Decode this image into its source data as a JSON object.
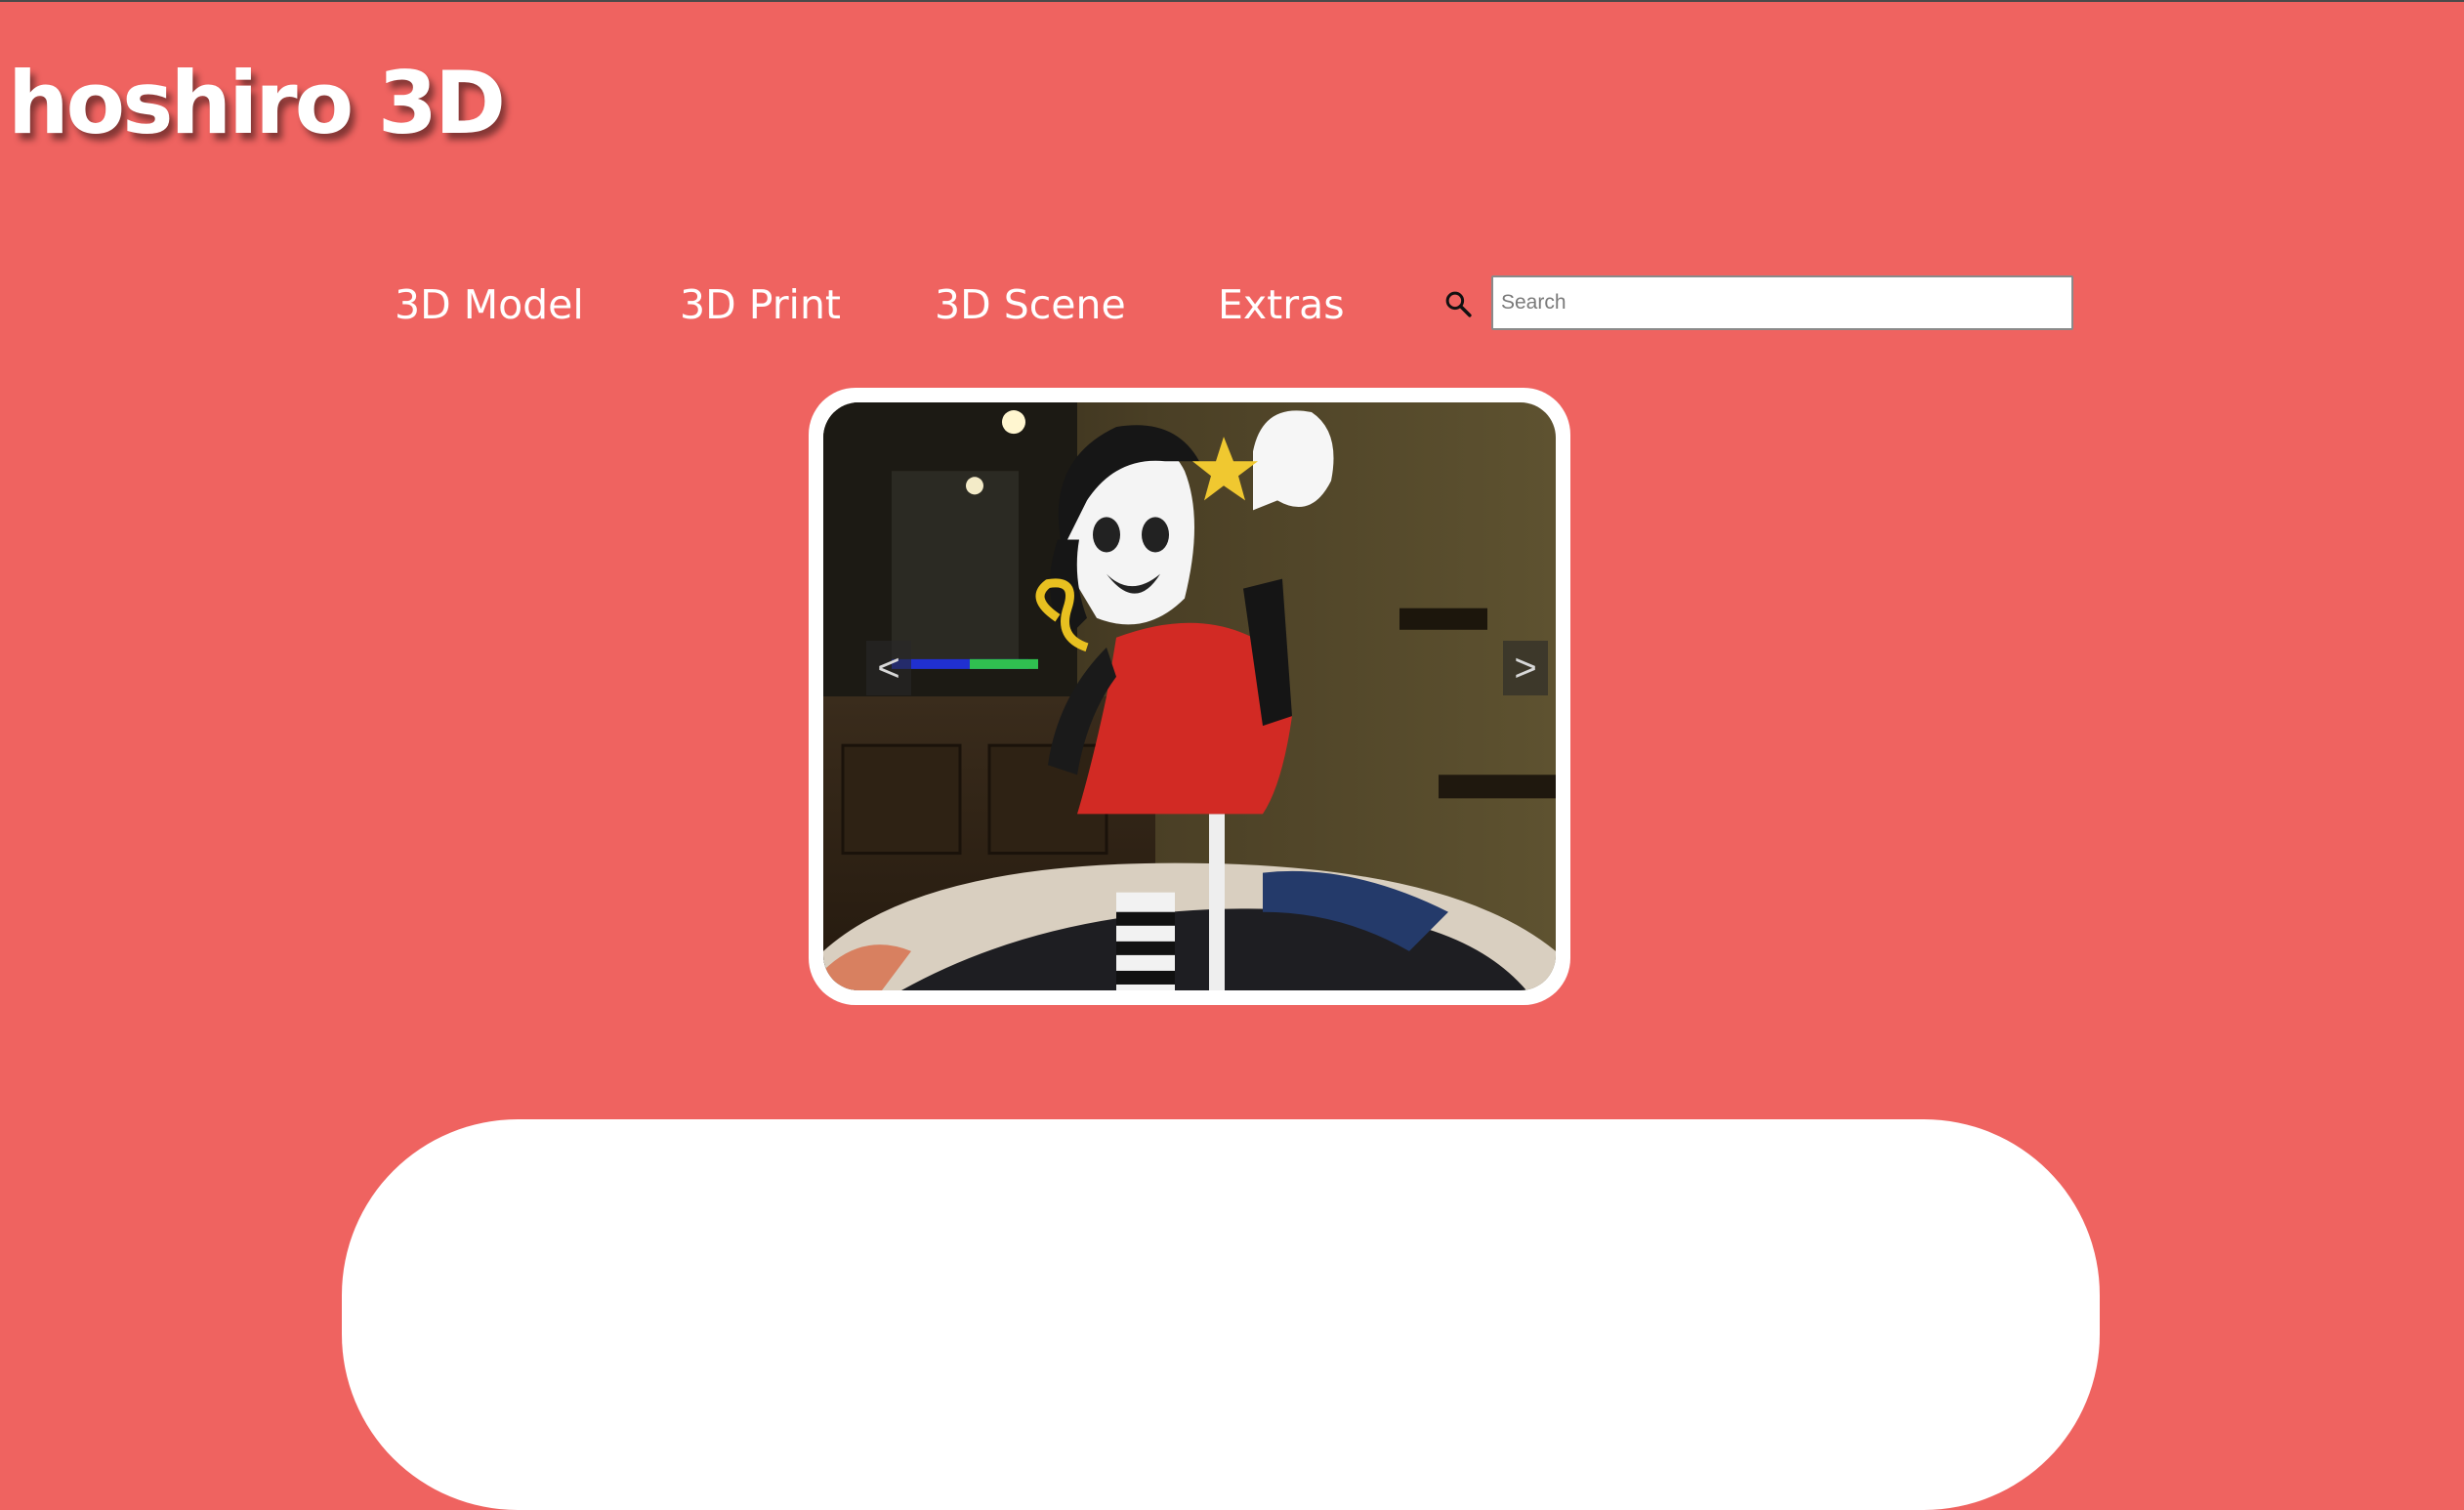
{
  "site": {
    "logo_text": "hoshiro 3D"
  },
  "nav": {
    "items": [
      {
        "label": "3D Model"
      },
      {
        "label": "3D Print"
      },
      {
        "label": "3D Scene"
      },
      {
        "label": "Extras"
      }
    ]
  },
  "search": {
    "placeholder": "Search",
    "value": "",
    "icon": "search-icon"
  },
  "slideshow": {
    "prev_label": "<",
    "next_label": ">",
    "image_alt": "3D printed figurine of a cartoon girl in a red dress"
  },
  "colors": {
    "background": "#ef6360",
    "text": "#ffffff",
    "frame_border": "#ffffff"
  }
}
